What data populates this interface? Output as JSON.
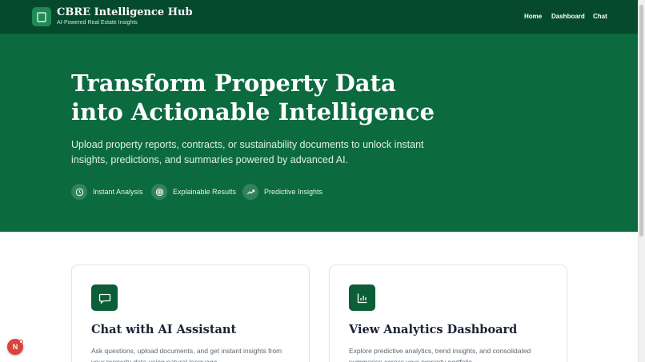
{
  "header": {
    "title": "CBRE Intelligence Hub",
    "subtitle": "AI-Powered Real Estate Insights",
    "nav": [
      {
        "label": "Home"
      },
      {
        "label": "Dashboard"
      },
      {
        "label": "Chat"
      }
    ]
  },
  "hero": {
    "title_line1": "Transform Property Data",
    "title_line2": "into Actionable Intelligence",
    "description": "Upload property reports, contracts, or sustainability documents to unlock instant insights, predictions, and summaries powered by advanced AI.",
    "features": [
      {
        "label": "Instant Analysis",
        "icon": "clock-icon"
      },
      {
        "label": "Explainable Results",
        "icon": "target-icon"
      },
      {
        "label": "Predictive Insights",
        "icon": "trending-up-icon"
      }
    ]
  },
  "cards": [
    {
      "title": "Chat with AI Assistant",
      "description": "Ask questions, upload documents, and get instant insights from your property data using natural language.",
      "icon": "chat-bubble-icon"
    },
    {
      "title": "View Analytics Dashboard",
      "description": "Explore predictive analytics, trend insights, and consolidated summaries across your property portfolio.",
      "icon": "bar-chart-icon"
    }
  ],
  "dev_badge": {
    "label": "N"
  },
  "colors": {
    "header_bg": "#064a2e",
    "hero_bg": "#0b6b3f",
    "accent": "#0b5e38",
    "badge": "#d9443c"
  }
}
